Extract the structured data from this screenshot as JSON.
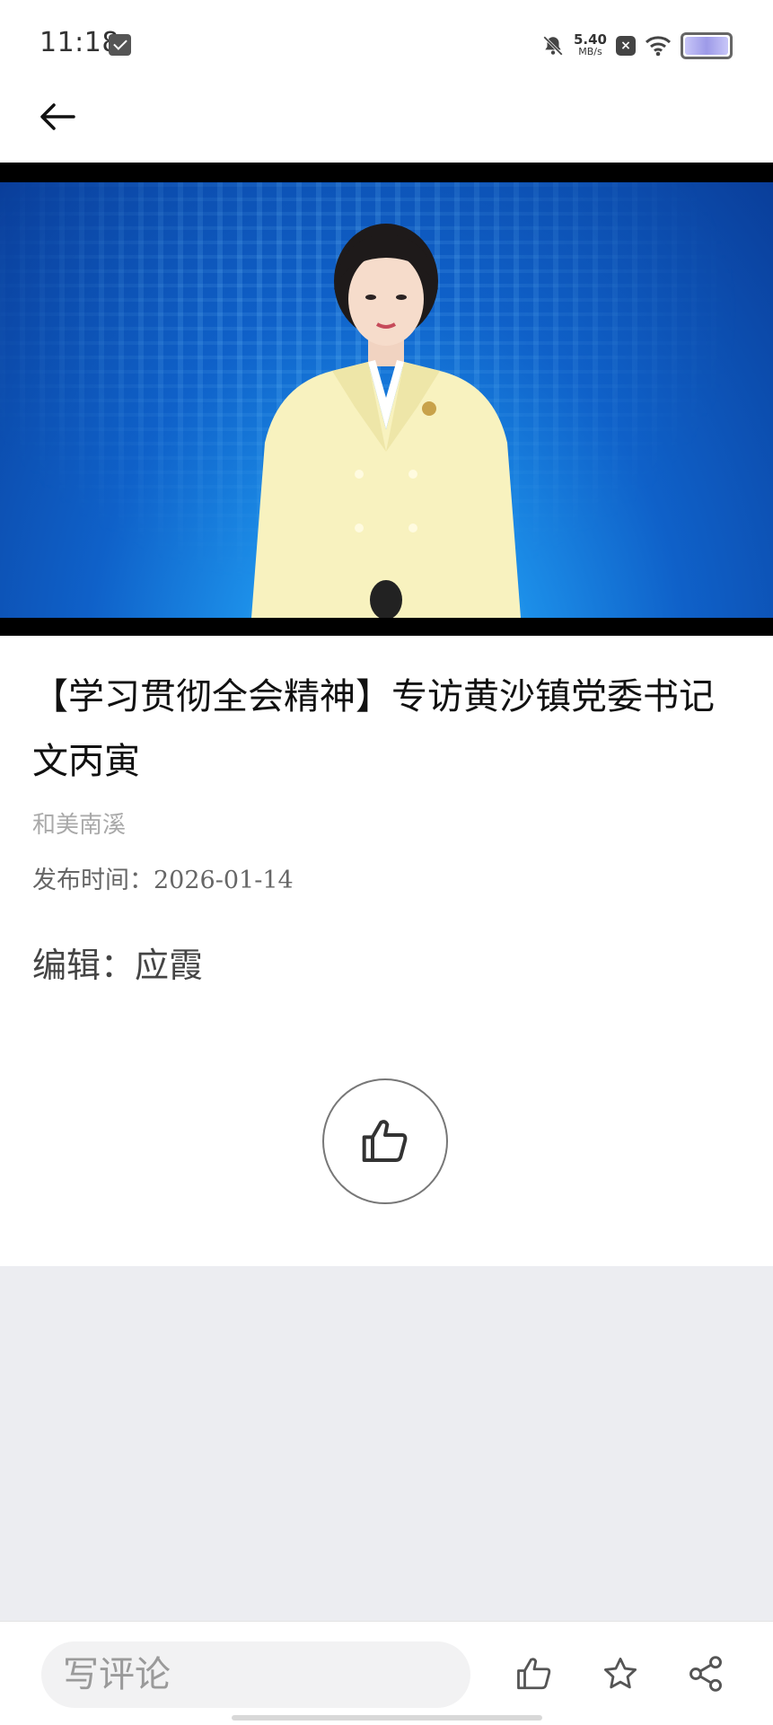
{
  "status_bar": {
    "time": "11:18",
    "net_speed_value": "5.40",
    "net_speed_unit": "MB/s"
  },
  "article": {
    "title": "【学习贯彻全会精神】专访黄沙镇党委书记 文丙寅",
    "source": "和美南溪",
    "publish_time": "发布时间：2026-01-14",
    "editor": "编辑：应霞"
  },
  "bottom_bar": {
    "comment_placeholder": "写评论"
  },
  "icons": {
    "back": "arrow-left-icon",
    "like": "thumbs-up-icon",
    "favorite": "star-icon",
    "share": "share-icon"
  },
  "colors": {
    "video_bg": "#0f61c9",
    "comments_bg": "#ecedf1",
    "source_text": "#a9a9a9"
  }
}
